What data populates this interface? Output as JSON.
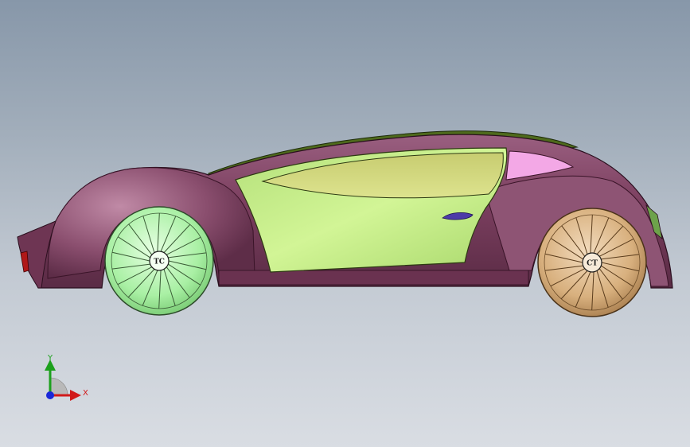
{
  "viewport": {
    "background_top": "#8797a9",
    "background_bottom": "#d9dde3"
  },
  "model": {
    "body_color": "#7b3f5f",
    "body_highlight": "#b07a96",
    "roof_color": "#4e6a1c",
    "door_panel_color": "#c6ec86",
    "window_color": "#d4d982",
    "rear_window_color": "#f3a8e6",
    "door_handle_color": "#4d3aa8",
    "front_wheel": {
      "color": "#a9f0a4",
      "hub_label": "TC"
    },
    "rear_wheel": {
      "color": "#d8b07e",
      "hub_label": "CT"
    }
  },
  "triad": {
    "x_label": "X",
    "y_label": "Y",
    "x_color": "#d11a1a",
    "y_color": "#1ca01c",
    "z_color": "#1a28d8"
  }
}
